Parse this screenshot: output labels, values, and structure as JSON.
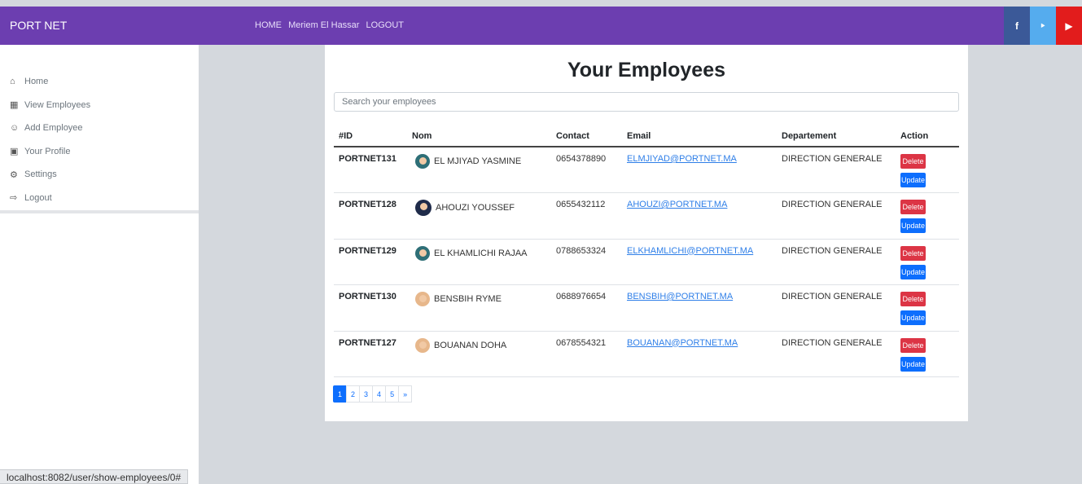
{
  "navbar": {
    "brand": "PORT NET",
    "links": [
      "HOME",
      "Meriem El Hassar",
      "LOGOUT"
    ],
    "social": [
      {
        "icon": "facebook-icon",
        "glyph": "f",
        "color": "#3b5998"
      },
      {
        "icon": "twitter-icon",
        "glyph": "‣",
        "color": "#55acee"
      },
      {
        "icon": "youtube-icon",
        "glyph": "▶",
        "color": "#e21c1c"
      }
    ]
  },
  "sidebar": {
    "items": [
      {
        "icon": "home-icon",
        "glyph": "⌂",
        "label": "Home"
      },
      {
        "icon": "id-card-icon",
        "glyph": "▦",
        "label": "View Employees"
      },
      {
        "icon": "user-plus-icon",
        "glyph": "☺",
        "label": "Add Employee"
      },
      {
        "icon": "profile-icon",
        "glyph": "▣",
        "label": "Your Profile"
      },
      {
        "icon": "cogs-icon",
        "glyph": "⚙",
        "label": "Settings"
      },
      {
        "icon": "logout-icon",
        "glyph": "⇨",
        "label": "Logout"
      }
    ]
  },
  "status_url": "localhost:8082/user/show-employees/0#",
  "main": {
    "title": "Your Employees",
    "search_placeholder": "Search your employees",
    "columns": [
      "#ID",
      "Nom",
      "Contact",
      "Email",
      "Departement",
      "Action"
    ],
    "delete_label": "Delete",
    "update_label": "Update",
    "rows": [
      {
        "id": "PORTNET131",
        "nom": "EL MJIYAD YASMINE",
        "avatar": "female-avatar-icon",
        "contact": "0654378890",
        "email": "ELMJIYAD@PORTNET.MA",
        "departement": "DIRECTION GENERALE"
      },
      {
        "id": "PORTNET128",
        "nom": "AHOUZI YOUSSEF",
        "avatar": "male-avatar-icon",
        "contact": "0655432112",
        "email": "AHOUZI@PORTNET.MA",
        "departement": "DIRECTION GENERALE"
      },
      {
        "id": "PORTNET129",
        "nom": "EL KHAMLICHI RAJAA",
        "avatar": "female-avatar-icon",
        "contact": "0788653324",
        "email": "ELKHAMLICHI@PORTNET.MA",
        "departement": "DIRECTION GENERALE"
      },
      {
        "id": "PORTNET130",
        "nom": "BENSBIH RYME",
        "avatar": "person-avatar-icon",
        "contact": "0688976654",
        "email": "BENSBIH@PORTNET.MA",
        "departement": "DIRECTION GENERALE"
      },
      {
        "id": "PORTNET127",
        "nom": "BOUANAN DOHA",
        "avatar": "person-avatar-icon",
        "contact": "0678554321",
        "email": "BOUANAN@PORTNET.MA",
        "departement": "DIRECTION GENERALE"
      }
    ],
    "pagination": {
      "pages": [
        "1",
        "2",
        "3",
        "4",
        "5"
      ],
      "next": "»",
      "current": "1"
    }
  }
}
